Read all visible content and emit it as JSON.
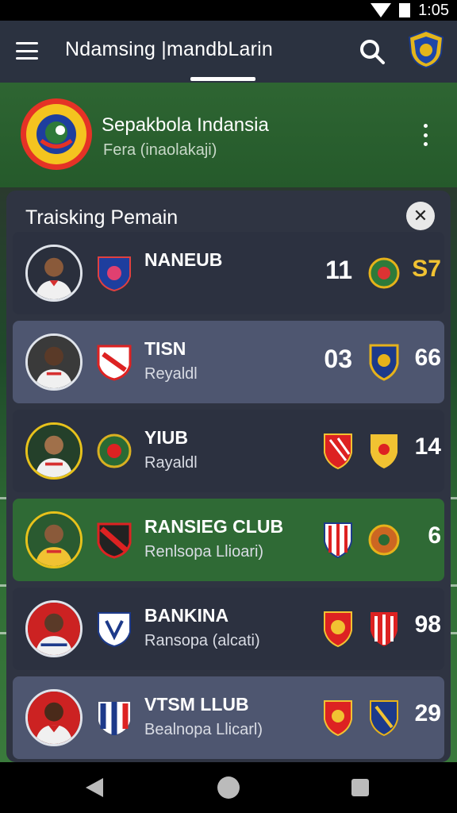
{
  "status_bar": {
    "time": "1:05"
  },
  "app_bar": {
    "title": "Ndamsing |mandbLarin"
  },
  "league": {
    "name": "Sepakbola Indansia",
    "subtitle": "Fera (inaolakaji)"
  },
  "panel": {
    "title": "Traisking Pemain"
  },
  "players": [
    {
      "name": "NANEUB",
      "club": "",
      "stat1": "11",
      "stat2": "S7",
      "style": "dark",
      "stat2_color": "#f1c232"
    },
    {
      "name": "TISN",
      "club": "Reyaldl",
      "stat1": "03",
      "stat2": "66",
      "style": "alt",
      "stat2_color": "#ffffff"
    },
    {
      "name": "YIUB",
      "club": "Rayaldl",
      "stat1": "",
      "stat2": "14",
      "style": "dark",
      "stat2_color": "#ffffff"
    },
    {
      "name": "RANSIEG CLUB",
      "club": "Renlsopa Llioari)",
      "stat1": "",
      "stat2": "6",
      "style": "green",
      "stat2_color": "#ffffff"
    },
    {
      "name": "BANKINA",
      "club": "Ransopa (alcati)",
      "stat1": "",
      "stat2": "98",
      "style": "dark",
      "stat2_color": "#ffffff"
    },
    {
      "name": "VTSM LLUB",
      "club": "Bealnopa Llicarl)",
      "stat1": "",
      "stat2": "29",
      "style": "alt",
      "stat2_color": "#ffffff"
    }
  ],
  "colors": {
    "app_bar": "#2b3240",
    "league_header": "#2e6532",
    "panel": "#2f3442",
    "accent_gold": "#f1c232"
  },
  "icons": {
    "menu": "menu-icon",
    "search": "search-icon",
    "more": "more-vert-icon",
    "close": "close-icon",
    "back": "back-icon",
    "home": "home-icon",
    "recent": "recent-apps-icon"
  }
}
